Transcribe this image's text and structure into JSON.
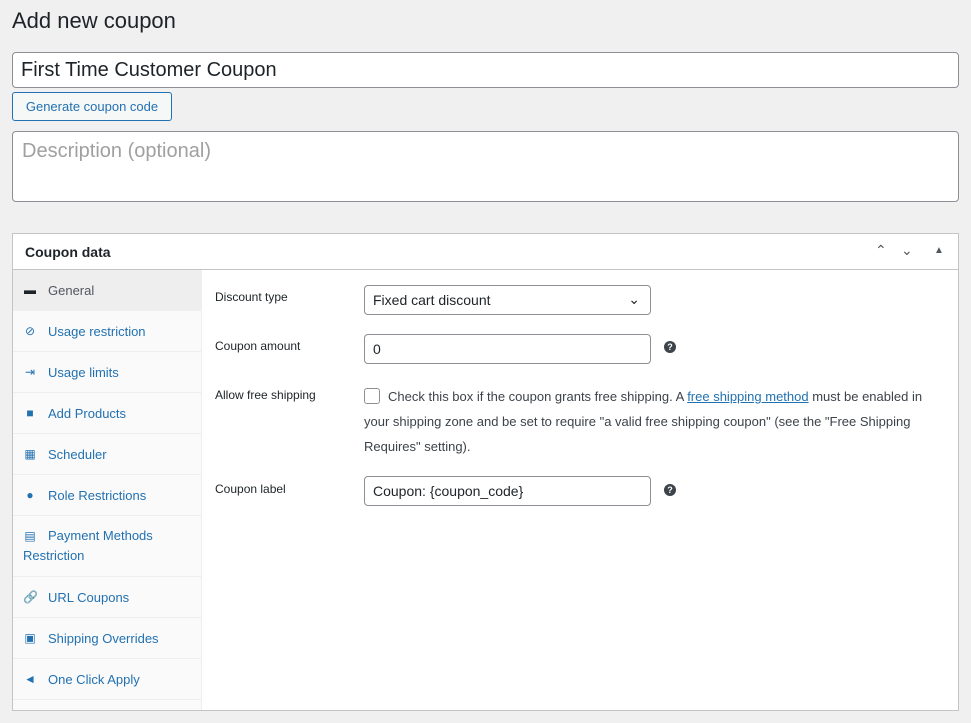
{
  "page_title": "Add new coupon",
  "coupon_title": "First Time Customer Coupon",
  "generate_label": "Generate coupon code",
  "description_placeholder": "Description (optional)",
  "panel": {
    "title": "Coupon data"
  },
  "tabs": [
    {
      "label": "General",
      "icon": "ticket-icon"
    },
    {
      "label": "Usage restriction",
      "icon": "block-icon"
    },
    {
      "label": "Usage limits",
      "icon": "limits-icon"
    },
    {
      "label": "Add Products",
      "icon": "bag-icon"
    },
    {
      "label": "Scheduler",
      "icon": "calendar-icon"
    },
    {
      "label": "Role Restrictions",
      "icon": "user-icon"
    },
    {
      "label": "Payment Methods Restriction",
      "icon": "card-icon"
    },
    {
      "label": "URL Coupons",
      "icon": "link-icon"
    },
    {
      "label": "Shipping Overrides",
      "icon": "truck-icon"
    },
    {
      "label": "One Click Apply",
      "icon": "megaphone-icon"
    }
  ],
  "fields": {
    "discount_type_label": "Discount type",
    "discount_type_value": "Fixed cart discount",
    "amount_label": "Coupon amount",
    "amount_value": "0",
    "free_shipping_label": "Allow free shipping",
    "free_shipping_text1": "Check this box if the coupon grants free shipping. A ",
    "free_shipping_link": "free shipping method",
    "free_shipping_text2": " must be enabled in your shipping zone and be set to require \"a valid free shipping coupon\" (see the \"Free Shipping Requires\" setting).",
    "coupon_label_label": "Coupon label",
    "coupon_label_value": "Coupon: {coupon_code}"
  }
}
